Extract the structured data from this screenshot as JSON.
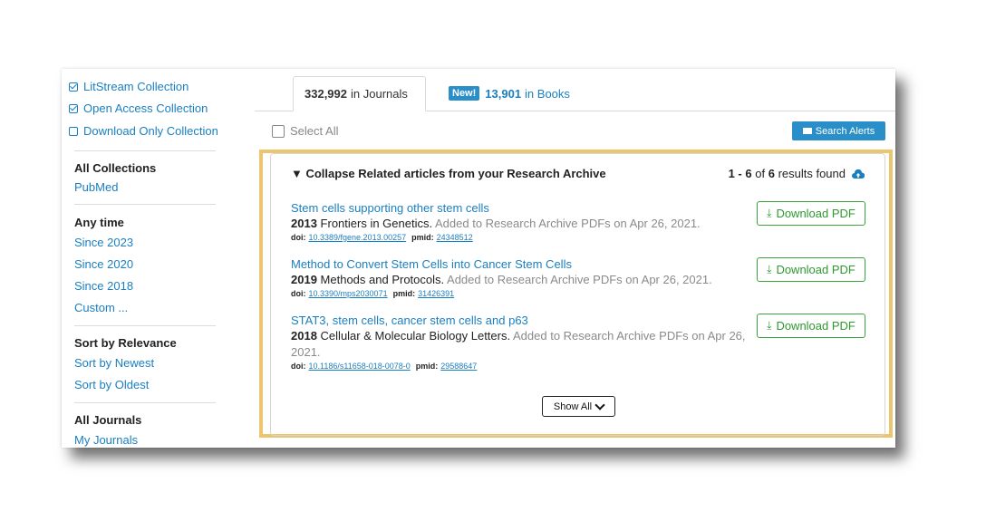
{
  "sidebar": {
    "collections": [
      {
        "label": "LitStream Collection",
        "checked": true
      },
      {
        "label": "Open Access Collection",
        "checked": true
      },
      {
        "label": "Download Only Collection",
        "checked": false
      }
    ],
    "all_collections": "All Collections",
    "pubmed": "PubMed",
    "any_time": "Any time",
    "since": [
      "Since 2023",
      "Since 2020",
      "Since 2018",
      "Custom ..."
    ],
    "sort_relevance": "Sort by Relevance",
    "sort_newest": "Sort by Newest",
    "sort_oldest": "Sort by Oldest",
    "all_journals": "All Journals",
    "my_journals": "My Journals"
  },
  "tabs": {
    "journals_count": "332,992",
    "journals_label": "in Journals",
    "new_badge": "New!",
    "books_count": "13,901",
    "books_label": "in Books"
  },
  "toolbar": {
    "select_all": "Select All",
    "search_alerts": "Search Alerts"
  },
  "panel": {
    "title": "▼ Collapse Related articles from your Research Archive",
    "range": "1 - 6",
    "of": "of",
    "total": "6",
    "results_found": "results found",
    "show_all": "Show All"
  },
  "articles": [
    {
      "title": "Stem cells supporting other stem cells",
      "year": "2013",
      "journal": "Frontiers in Genetics.",
      "added": "Added to Research Archive PDFs on Apr 26, 2021.",
      "doi_label": "doi:",
      "doi": "10.3389/fgene.2013.00257",
      "pmid_label": "pmid:",
      "pmid": "24348512",
      "download": "Download PDF"
    },
    {
      "title": "Method to Convert Stem Cells into Cancer Stem Cells",
      "year": "2019",
      "journal": "Methods and Protocols.",
      "added": "Added to Research Archive PDFs on Apr 26, 2021.",
      "doi_label": "doi:",
      "doi": "10.3390/mps2030071",
      "pmid_label": "pmid:",
      "pmid": "31426391",
      "download": "Download PDF"
    },
    {
      "title": "STAT3, stem cells, cancer stem cells and p63",
      "year": "2018",
      "journal": "Cellular & Molecular Biology Letters.",
      "added": "Added to Research Archive PDFs on Apr 26, 2021.",
      "doi_label": "doi:",
      "doi": "10.1186/s11658-018-0078-0",
      "pmid_label": "pmid:",
      "pmid": "29588647",
      "download": "Download PDF"
    }
  ],
  "colors": {
    "link": "#1a7fc1",
    "highlight": "#ecc56f",
    "arrow": "#f0a23c",
    "download": "#2f9a2f",
    "accent": "#2a8fc8"
  }
}
